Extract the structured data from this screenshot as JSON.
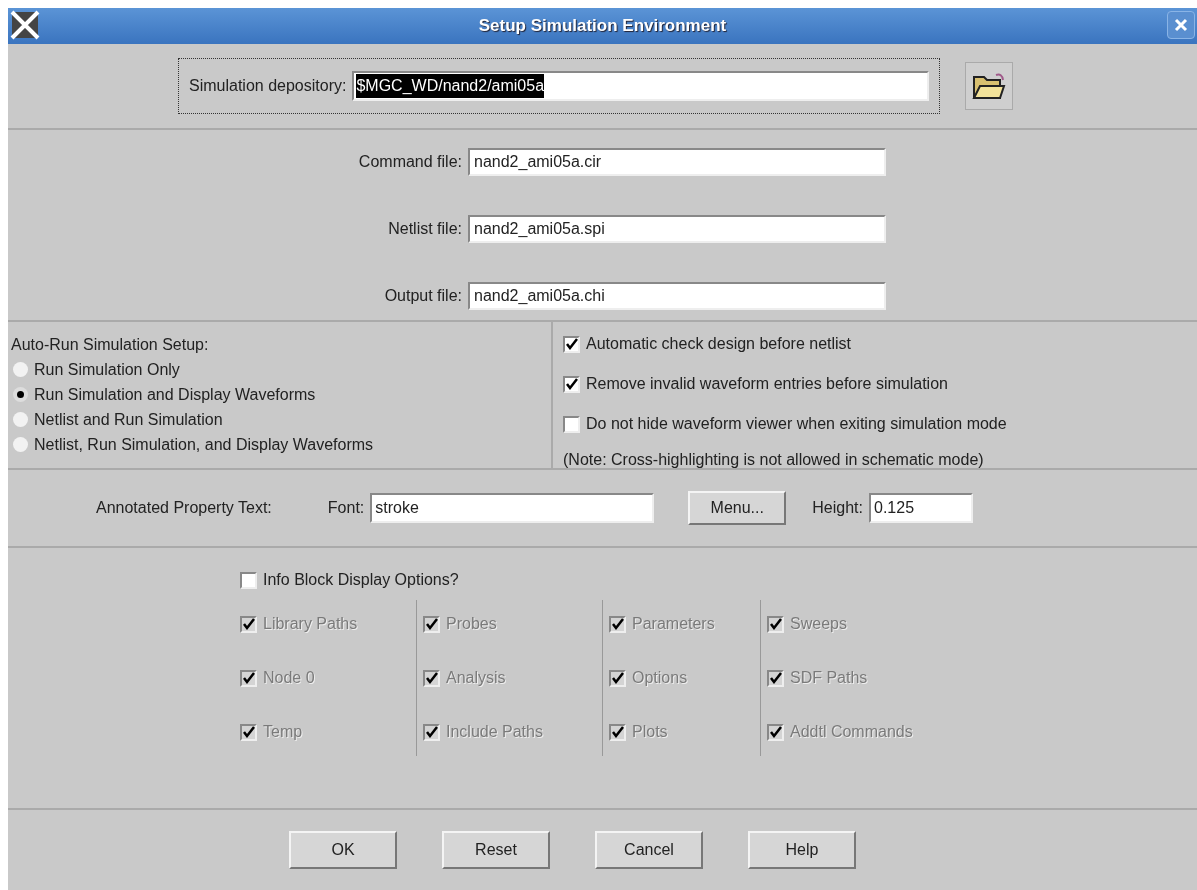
{
  "window": {
    "title": "Setup Simulation Environment"
  },
  "depository": {
    "label": "Simulation depository:",
    "value": "$MGC_WD/nand2/ami05a",
    "selected_text": true
  },
  "files": [
    {
      "label": "Command file:",
      "value": "nand2_ami05a.cir"
    },
    {
      "label": "Netlist file:",
      "value": "nand2_ami05a.spi"
    },
    {
      "label": "Output file:",
      "value": "nand2_ami05a.chi"
    }
  ],
  "auto_run": {
    "title": "Auto-Run Simulation Setup:",
    "options": [
      {
        "label": "Run Simulation Only",
        "selected": false
      },
      {
        "label": "Run Simulation and Display Waveforms",
        "selected": true
      },
      {
        "label": "Netlist and Run Simulation",
        "selected": false
      },
      {
        "label": "Netlist, Run Simulation, and Display Waveforms",
        "selected": false
      }
    ]
  },
  "checks": [
    {
      "label": "Automatic check design before netlist",
      "checked": true
    },
    {
      "label": "Remove invalid waveform entries before simulation",
      "checked": true
    },
    {
      "label": "Do not hide waveform viewer when exiting simulation mode",
      "checked": false
    }
  ],
  "note": "(Note: Cross-highlighting is not allowed in schematic mode)",
  "annotated": {
    "title": "Annotated Property Text:",
    "font_label": "Font:",
    "font_value": "stroke",
    "menu_button": "Menu...",
    "height_label": "Height:",
    "height_value": "0.125"
  },
  "info_block": {
    "label": "Info Block Display Options?",
    "checked": false,
    "columns": [
      [
        {
          "label": "Library Paths",
          "checked": true,
          "disabled": true
        },
        {
          "label": "Node 0",
          "checked": true,
          "disabled": true
        },
        {
          "label": "Temp",
          "checked": true,
          "disabled": true
        }
      ],
      [
        {
          "label": "Probes",
          "checked": true,
          "disabled": true
        },
        {
          "label": "Analysis",
          "checked": true,
          "disabled": true
        },
        {
          "label": "Include Paths",
          "checked": true,
          "disabled": true
        }
      ],
      [
        {
          "label": "Parameters",
          "checked": true,
          "disabled": true
        },
        {
          "label": "Options",
          "checked": true,
          "disabled": true
        },
        {
          "label": "Plots",
          "checked": true,
          "disabled": true
        }
      ],
      [
        {
          "label": "Sweeps",
          "checked": true,
          "disabled": true
        },
        {
          "label": "SDF Paths",
          "checked": true,
          "disabled": true
        },
        {
          "label": "Addtl Commands",
          "checked": true,
          "disabled": true
        }
      ]
    ]
  },
  "buttons": [
    "OK",
    "Reset",
    "Cancel",
    "Help"
  ]
}
